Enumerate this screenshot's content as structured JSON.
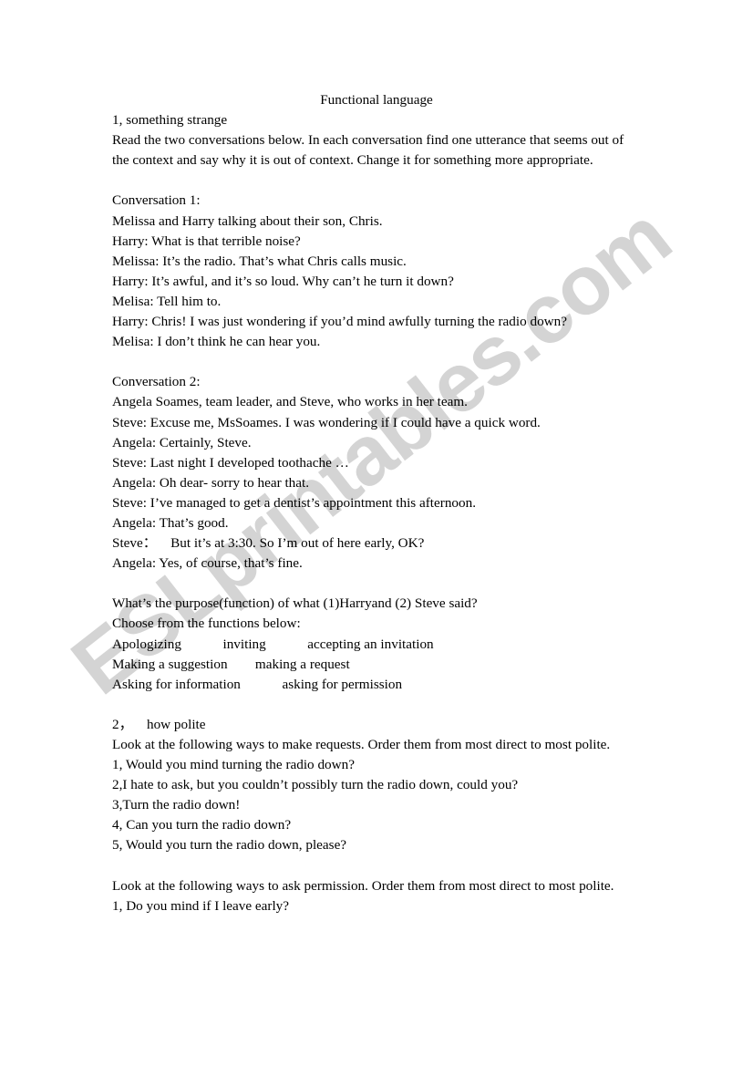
{
  "document": {
    "title": "Functional language",
    "section1_heading": "1, something strange",
    "section1_instructions": "Read the two conversations below. In each conversation find one utterance that seems out of the context and say why it is out of context. Change it for something more appropriate.",
    "conversation1": {
      "heading": "Conversation 1:",
      "setting": "Melissa and Harry talking about their son, Chris.",
      "lines": [
        "Harry: What is that terrible noise?",
        "Melissa: It’s the radio. That’s what Chris calls music.",
        "Harry: It’s awful, and it’s so loud. Why can’t he turn it down?",
        "Melisa: Tell him to.",
        "Harry: Chris! I was just wondering if you’d mind awfully turning the radio down?",
        "Melisa: I don’t think he can hear you."
      ]
    },
    "conversation2": {
      "heading": "Conversation 2:",
      "setting": "Angela Soames, team leader, and Steve, who works in her team.",
      "lines": [
        "Steve: Excuse me, MsSoames. I was wondering if I could have a quick word.",
        "Angela: Certainly, Steve.",
        "Steve: Last night I developed toothache …",
        "Angela: Oh dear- sorry to hear that.",
        "Steve: I’ve managed to get a dentist’s appointment this afternoon.",
        "Angela: That’s good.",
        "Steve：    But it’s at 3:30. So I’m out of here early, OK?",
        "Angela: Yes, of course, that’s fine."
      ]
    },
    "purpose_question": "What’s the purpose(function) of what (1)Harryand (2) Steve said?",
    "choose_prompt": "Choose from the functions below:",
    "function_options_lines": [
      "Apologizing            inviting            accepting an invitation",
      "Making a suggestion        making a request",
      "Asking for information            asking for permission"
    ],
    "section2_heading": "2，    how polite",
    "requests_instructions": "Look at the following ways to make requests. Order them from most direct to most polite.",
    "request_items": [
      "1, Would you mind turning the radio down?",
      "2,I hate to ask, but you couldn’t possibly turn the radio down, could you?",
      "3,Turn the radio down!",
      "4, Can you turn the radio down?",
      "5, Would you turn the radio down, please?"
    ],
    "permission_instructions": "Look at the following ways to ask permission. Order them from most direct to most polite.",
    "permission_items": [
      "1, Do you mind if I leave early?"
    ]
  },
  "watermark": {
    "text": "ESLprintables.com",
    "color": "#d4d4d4"
  }
}
